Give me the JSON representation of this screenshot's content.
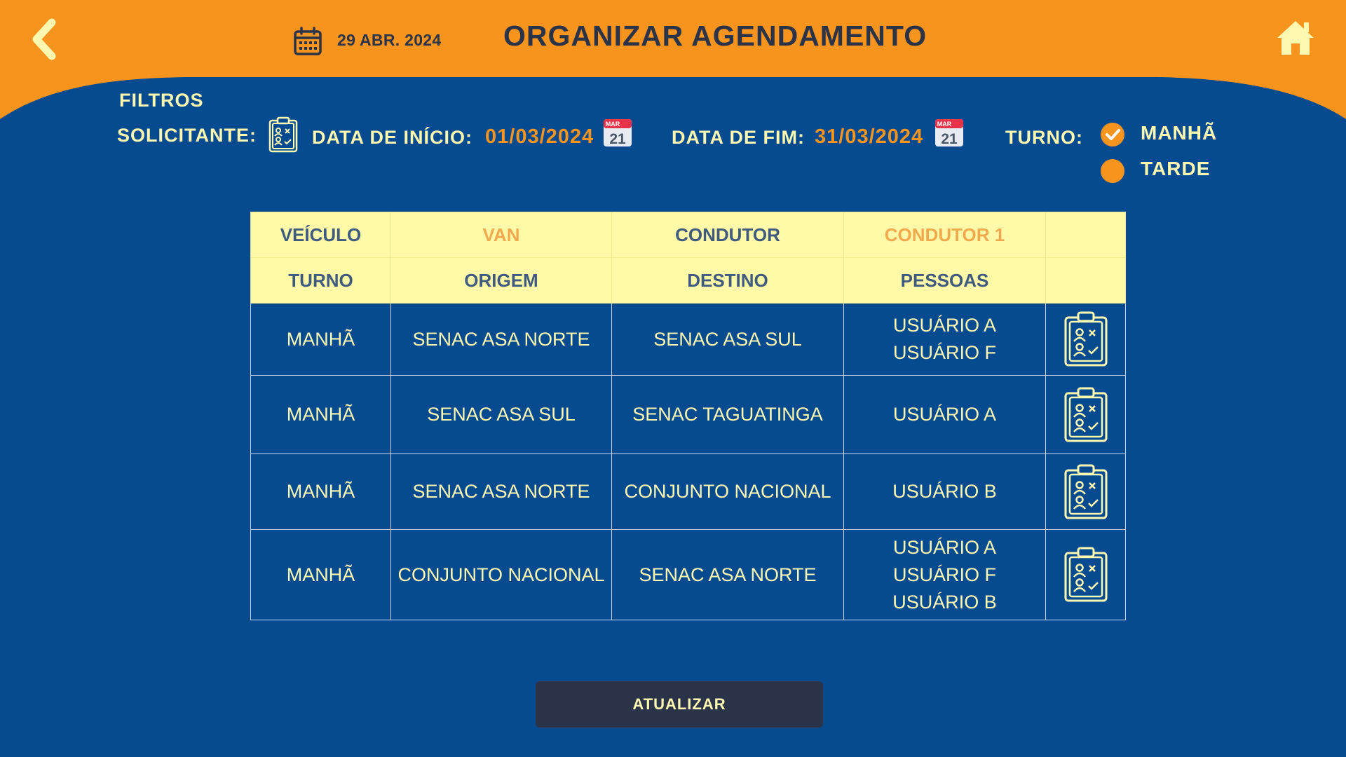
{
  "header": {
    "date": "29 ABR. 2024",
    "title": "ORGANIZAR AGENDAMENTO",
    "colors": {
      "orange": "#f7941e",
      "navy": "#2b3348",
      "blue": "#064a8f",
      "cream": "#fff8b0"
    }
  },
  "filters": {
    "section_label": "FILTROS",
    "requester_label": "SOLICITANTE:",
    "start_label": "DATA DE INÍCIO:",
    "start_value": "01/03/2024",
    "end_label": "DATA DE FIM:",
    "end_value": "31/03/2024",
    "calendar_month": "MAR",
    "calendar_day": "21",
    "shift_label": "TURNO:",
    "shift_options": [
      {
        "label": "MANHÃ",
        "checked": true
      },
      {
        "label": "TARDE",
        "checked": false
      }
    ]
  },
  "table": {
    "header_row1": [
      "VEÍCULO",
      "VAN",
      "CONDUTOR",
      "CONDUTOR 1",
      ""
    ],
    "header_row2": [
      "TURNO",
      "ORIGEM",
      "DESTINO",
      "PESSOAS",
      ""
    ],
    "rows": [
      {
        "turno": "MANHÃ",
        "origem": "SENAC ASA NORTE",
        "destino": "SENAC ASA SUL",
        "pessoas": [
          "USUÁRIO A",
          "USUÁRIO F"
        ]
      },
      {
        "turno": "MANHÃ",
        "origem": "SENAC ASA SUL",
        "destino": "SENAC TAGUATINGA",
        "pessoas": [
          "USUÁRIO A"
        ]
      },
      {
        "turno": "MANHÃ",
        "origem": "SENAC ASA NORTE",
        "destino": "CONJUNTO NACIONAL",
        "pessoas": [
          "USUÁRIO B"
        ]
      },
      {
        "turno": "MANHÃ",
        "origem": "CONJUNTO NACIONAL",
        "destino": "SENAC ASA NORTE",
        "pessoas": [
          "USUÁRIO A",
          "USUÁRIO F",
          "USUÁRIO B"
        ]
      }
    ]
  },
  "actions": {
    "update_label": "ATUALIZAR"
  },
  "icons": {
    "back": "chevron-left-icon",
    "home": "home-icon",
    "date": "calendar-icon",
    "requester": "clipboard-users-icon",
    "row_action": "clipboard-users-icon"
  }
}
